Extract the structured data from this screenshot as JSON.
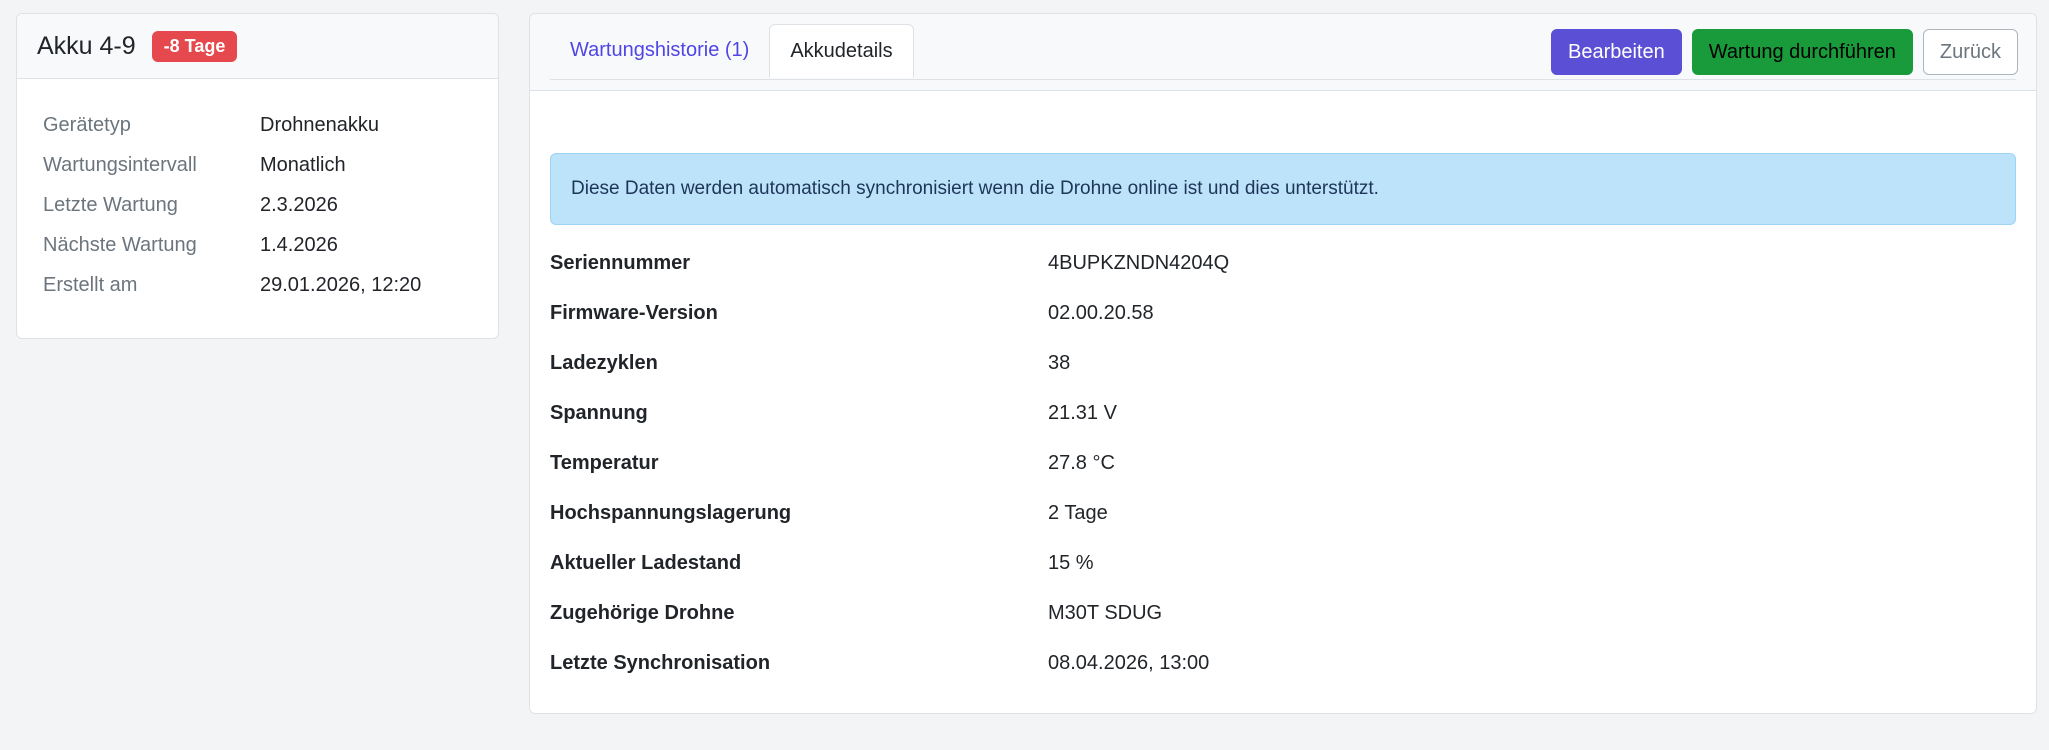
{
  "device": {
    "title": "Akku 4-9",
    "badge": "-8 Tage",
    "props": [
      {
        "label": "Gerätetyp",
        "value": "Drohnenakku"
      },
      {
        "label": "Wartungsintervall",
        "value": "Monatlich"
      },
      {
        "label": "Letzte Wartung",
        "value": "2.3.2026"
      },
      {
        "label": "Nächste Wartung",
        "value": "1.4.2026"
      },
      {
        "label": "Erstellt am",
        "value": "29.01.2026, 12:20"
      }
    ]
  },
  "tabs": {
    "history": "Wartungshistorie (1)",
    "details": "Akkudetails"
  },
  "actions": {
    "edit": "Bearbeiten",
    "maintenance": "Wartung durchführen",
    "back": "Zurück"
  },
  "alert": {
    "text": "Diese Daten werden automatisch synchronisiert wenn die Drohne online ist und dies unterstützt."
  },
  "specs": [
    {
      "label": "Seriennummer",
      "value": "4BUPKZNDN4204Q"
    },
    {
      "label": "Firmware-Version",
      "value": "02.00.20.58"
    },
    {
      "label": "Ladezyklen",
      "value": "38"
    },
    {
      "label": "Spannung",
      "value": "21.31 V"
    },
    {
      "label": "Temperatur",
      "value": "27.8 °C"
    },
    {
      "label": "Hochspannungslagerung",
      "value": "2 Tage"
    },
    {
      "label": "Aktueller Ladestand",
      "value": "15 %"
    },
    {
      "label": "Zugehörige Drohne",
      "value": "M30T SDUG"
    },
    {
      "label": "Letzte Synchronisation",
      "value": "08.04.2026, 13:00"
    }
  ],
  "colors": {
    "badge": "#e5484d",
    "edit_button": "#5b4fd6",
    "maintenance_button": "#1a9b3b",
    "tab_link": "#4f46e5",
    "alert_bg": "#bde3fb"
  }
}
